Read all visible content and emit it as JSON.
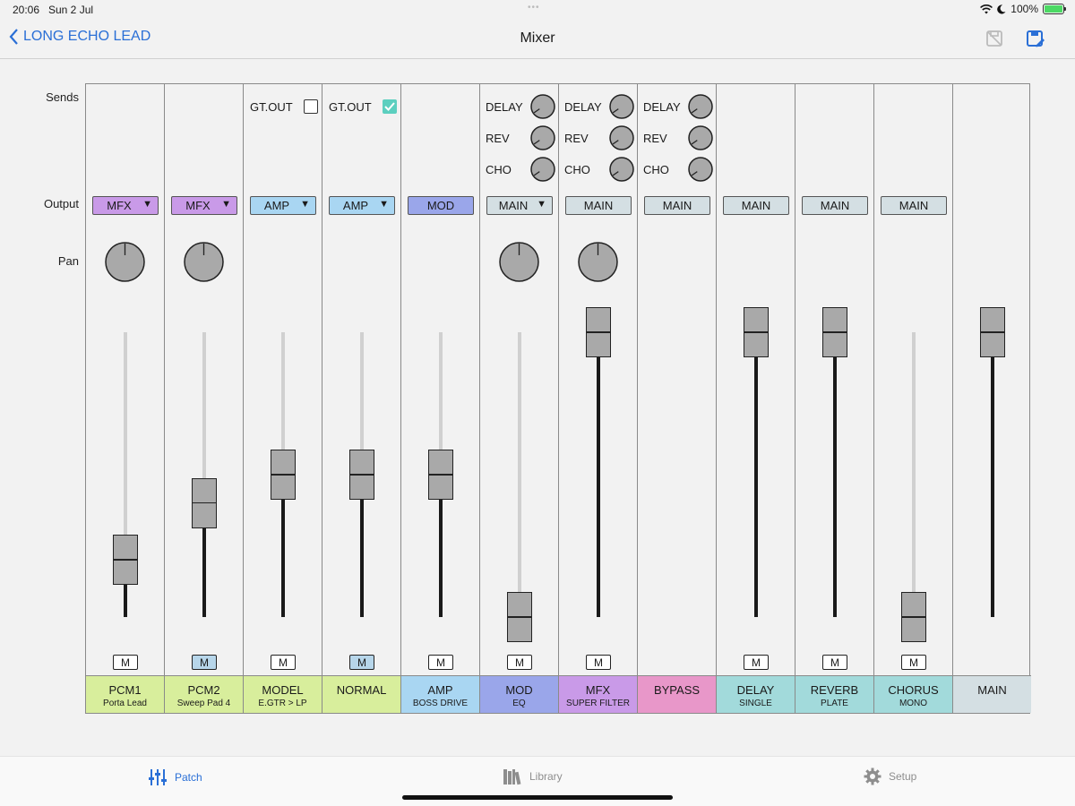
{
  "status": {
    "time": "20:06",
    "date": "Sun 2 Jul",
    "battery": "100%"
  },
  "nav": {
    "back_label": "LONG ECHO LEAD",
    "title": "Mixer"
  },
  "row_labels": {
    "sends": "Sends",
    "output": "Output",
    "pan": "Pan"
  },
  "send_labels": {
    "delay": "DELAY",
    "rev": "REV",
    "cho": "CHO"
  },
  "channels": [
    {
      "name": "PCM1",
      "sub": "Porta Lead",
      "color": "#d8ee9c",
      "output": "MFX",
      "output_dropdown": true,
      "output_color": "#c99ae8",
      "pan": true,
      "fader": 0.2,
      "mute": "M",
      "mute_on": false
    },
    {
      "name": "PCM2",
      "sub": "Sweep Pad 4",
      "color": "#d8ee9c",
      "output": "MFX",
      "output_dropdown": true,
      "output_color": "#c99ae8",
      "pan": true,
      "fader": 0.4,
      "mute": "M",
      "mute_on": true
    },
    {
      "name": "MODEL",
      "sub": "E.GTR > LP",
      "color": "#d8ee9c",
      "gt_out": "GT.OUT",
      "gt_checked": false,
      "output": "AMP",
      "output_dropdown": true,
      "output_color": "#a9d6f2",
      "fader": 0.5,
      "mute": "M",
      "mute_on": false
    },
    {
      "name": "NORMAL",
      "sub": "",
      "color": "#d8ee9c",
      "gt_out": "GT.OUT",
      "gt_checked": true,
      "output": "AMP",
      "output_dropdown": true,
      "output_color": "#a9d6f2",
      "fader": 0.5,
      "mute": "M",
      "mute_on": true
    },
    {
      "name": "AMP",
      "sub": "BOSS DRIVE",
      "color": "#a9d6f2",
      "output": "MOD",
      "output_dropdown": false,
      "output_color": "#9aa6ea",
      "fader": 0.5,
      "mute": "M",
      "mute_on": false
    },
    {
      "name": "MOD",
      "sub": "EQ",
      "color": "#9aa6ea",
      "sends": true,
      "output": "MAIN",
      "output_dropdown": true,
      "output_color": "#d4dfe3",
      "pan": true,
      "fader": 0.0,
      "mute": "M",
      "mute_on": false
    },
    {
      "name": "MFX",
      "sub": "SUPER FILTER",
      "color": "#c99ae8",
      "sends": true,
      "output": "MAIN",
      "output_dropdown": false,
      "output_color": "#d4dfe3",
      "pan": true,
      "fader": 1.0,
      "mute": "M",
      "mute_on": false
    },
    {
      "name": "BYPASS",
      "sub": "",
      "color": "#e897c9",
      "sends": true,
      "output": "MAIN",
      "output_dropdown": false,
      "output_color": "#d4dfe3"
    },
    {
      "name": "DELAY",
      "sub": "SINGLE",
      "color": "#a2dadb",
      "output": "MAIN",
      "output_dropdown": false,
      "output_color": "#d4dfe3",
      "fader": 1.0,
      "mute": "M",
      "mute_on": false
    },
    {
      "name": "REVERB",
      "sub": "PLATE",
      "color": "#a2dadb",
      "output": "MAIN",
      "output_dropdown": false,
      "output_color": "#d4dfe3",
      "fader": 1.0,
      "mute": "M",
      "mute_on": false
    },
    {
      "name": "CHORUS",
      "sub": "MONO",
      "color": "#a2dadb",
      "output": "MAIN",
      "output_dropdown": false,
      "output_color": "#d4dfe3",
      "fader": 0.0,
      "mute": "M",
      "mute_on": false
    },
    {
      "name": "MAIN",
      "sub": "",
      "color": "#d4dfe3",
      "fader": 1.0
    }
  ],
  "tabs": [
    {
      "label": "Patch",
      "icon": "sliders-icon",
      "active": true
    },
    {
      "label": "Library",
      "icon": "library-icon",
      "active": false
    },
    {
      "label": "Setup",
      "icon": "gear-icon",
      "active": false
    }
  ]
}
